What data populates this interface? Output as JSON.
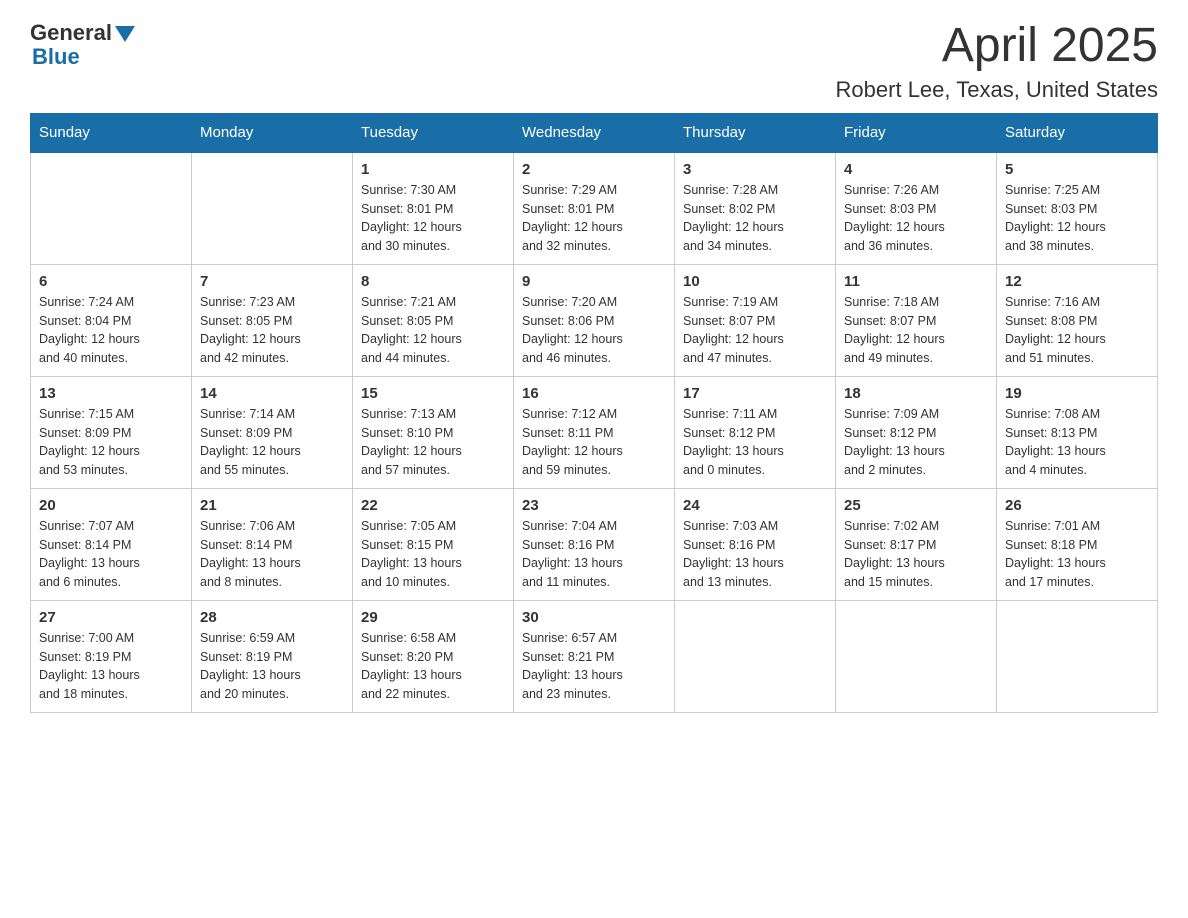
{
  "logo": {
    "general": "General",
    "blue": "Blue"
  },
  "title": "April 2025",
  "subtitle": "Robert Lee, Texas, United States",
  "days_of_week": [
    "Sunday",
    "Monday",
    "Tuesday",
    "Wednesday",
    "Thursday",
    "Friday",
    "Saturday"
  ],
  "weeks": [
    [
      {
        "day": "",
        "info": ""
      },
      {
        "day": "",
        "info": ""
      },
      {
        "day": "1",
        "info": "Sunrise: 7:30 AM\nSunset: 8:01 PM\nDaylight: 12 hours\nand 30 minutes."
      },
      {
        "day": "2",
        "info": "Sunrise: 7:29 AM\nSunset: 8:01 PM\nDaylight: 12 hours\nand 32 minutes."
      },
      {
        "day": "3",
        "info": "Sunrise: 7:28 AM\nSunset: 8:02 PM\nDaylight: 12 hours\nand 34 minutes."
      },
      {
        "day": "4",
        "info": "Sunrise: 7:26 AM\nSunset: 8:03 PM\nDaylight: 12 hours\nand 36 minutes."
      },
      {
        "day": "5",
        "info": "Sunrise: 7:25 AM\nSunset: 8:03 PM\nDaylight: 12 hours\nand 38 minutes."
      }
    ],
    [
      {
        "day": "6",
        "info": "Sunrise: 7:24 AM\nSunset: 8:04 PM\nDaylight: 12 hours\nand 40 minutes."
      },
      {
        "day": "7",
        "info": "Sunrise: 7:23 AM\nSunset: 8:05 PM\nDaylight: 12 hours\nand 42 minutes."
      },
      {
        "day": "8",
        "info": "Sunrise: 7:21 AM\nSunset: 8:05 PM\nDaylight: 12 hours\nand 44 minutes."
      },
      {
        "day": "9",
        "info": "Sunrise: 7:20 AM\nSunset: 8:06 PM\nDaylight: 12 hours\nand 46 minutes."
      },
      {
        "day": "10",
        "info": "Sunrise: 7:19 AM\nSunset: 8:07 PM\nDaylight: 12 hours\nand 47 minutes."
      },
      {
        "day": "11",
        "info": "Sunrise: 7:18 AM\nSunset: 8:07 PM\nDaylight: 12 hours\nand 49 minutes."
      },
      {
        "day": "12",
        "info": "Sunrise: 7:16 AM\nSunset: 8:08 PM\nDaylight: 12 hours\nand 51 minutes."
      }
    ],
    [
      {
        "day": "13",
        "info": "Sunrise: 7:15 AM\nSunset: 8:09 PM\nDaylight: 12 hours\nand 53 minutes."
      },
      {
        "day": "14",
        "info": "Sunrise: 7:14 AM\nSunset: 8:09 PM\nDaylight: 12 hours\nand 55 minutes."
      },
      {
        "day": "15",
        "info": "Sunrise: 7:13 AM\nSunset: 8:10 PM\nDaylight: 12 hours\nand 57 minutes."
      },
      {
        "day": "16",
        "info": "Sunrise: 7:12 AM\nSunset: 8:11 PM\nDaylight: 12 hours\nand 59 minutes."
      },
      {
        "day": "17",
        "info": "Sunrise: 7:11 AM\nSunset: 8:12 PM\nDaylight: 13 hours\nand 0 minutes."
      },
      {
        "day": "18",
        "info": "Sunrise: 7:09 AM\nSunset: 8:12 PM\nDaylight: 13 hours\nand 2 minutes."
      },
      {
        "day": "19",
        "info": "Sunrise: 7:08 AM\nSunset: 8:13 PM\nDaylight: 13 hours\nand 4 minutes."
      }
    ],
    [
      {
        "day": "20",
        "info": "Sunrise: 7:07 AM\nSunset: 8:14 PM\nDaylight: 13 hours\nand 6 minutes."
      },
      {
        "day": "21",
        "info": "Sunrise: 7:06 AM\nSunset: 8:14 PM\nDaylight: 13 hours\nand 8 minutes."
      },
      {
        "day": "22",
        "info": "Sunrise: 7:05 AM\nSunset: 8:15 PM\nDaylight: 13 hours\nand 10 minutes."
      },
      {
        "day": "23",
        "info": "Sunrise: 7:04 AM\nSunset: 8:16 PM\nDaylight: 13 hours\nand 11 minutes."
      },
      {
        "day": "24",
        "info": "Sunrise: 7:03 AM\nSunset: 8:16 PM\nDaylight: 13 hours\nand 13 minutes."
      },
      {
        "day": "25",
        "info": "Sunrise: 7:02 AM\nSunset: 8:17 PM\nDaylight: 13 hours\nand 15 minutes."
      },
      {
        "day": "26",
        "info": "Sunrise: 7:01 AM\nSunset: 8:18 PM\nDaylight: 13 hours\nand 17 minutes."
      }
    ],
    [
      {
        "day": "27",
        "info": "Sunrise: 7:00 AM\nSunset: 8:19 PM\nDaylight: 13 hours\nand 18 minutes."
      },
      {
        "day": "28",
        "info": "Sunrise: 6:59 AM\nSunset: 8:19 PM\nDaylight: 13 hours\nand 20 minutes."
      },
      {
        "day": "29",
        "info": "Sunrise: 6:58 AM\nSunset: 8:20 PM\nDaylight: 13 hours\nand 22 minutes."
      },
      {
        "day": "30",
        "info": "Sunrise: 6:57 AM\nSunset: 8:21 PM\nDaylight: 13 hours\nand 23 minutes."
      },
      {
        "day": "",
        "info": ""
      },
      {
        "day": "",
        "info": ""
      },
      {
        "day": "",
        "info": ""
      }
    ]
  ]
}
